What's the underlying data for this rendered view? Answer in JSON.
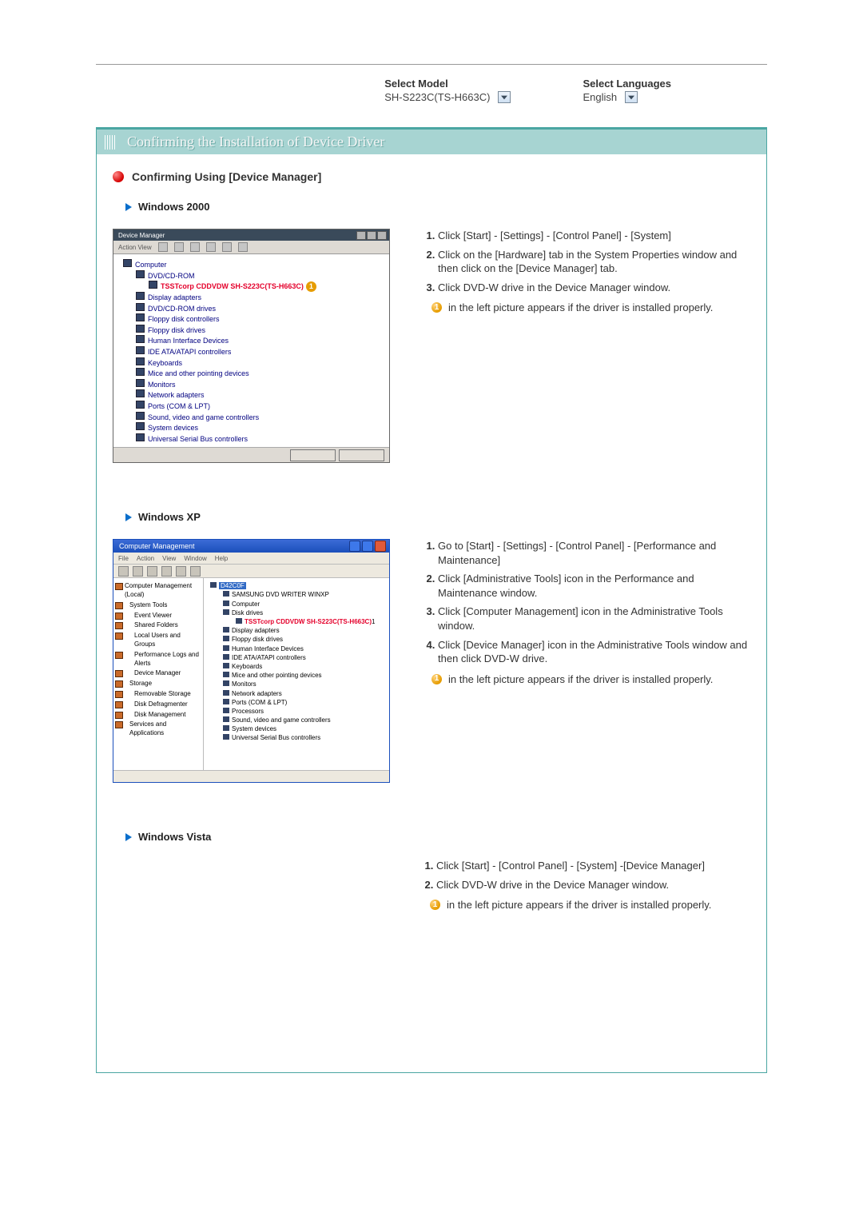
{
  "selectors": {
    "model_label": "Select Model",
    "model_value": "SH-S223C(TS-H663C)",
    "lang_label": "Select Languages",
    "lang_value": "English"
  },
  "title": "Confirming the Installation of Device Driver",
  "section_heading": "Confirming Using [Device Manager]",
  "sub_win2000": "Windows 2000",
  "sub_winxp": "Windows XP",
  "sub_vista": "Windows Vista",
  "proper_note": " in the left picture appears if the driver is installed properly.",
  "orb_glyph": "1",
  "win2000": {
    "window_title": "Device Manager",
    "menus": "Action  View",
    "tree": {
      "root": "Computer",
      "dvdcdrom": "DVD/CD-ROM",
      "device": "TSSTcorp CDDVDW SH-S223C(TS-H663C)",
      "items": [
        "Display adapters",
        "DVD/CD-ROM drives",
        "Floppy disk controllers",
        "Floppy disk drives",
        "Human Interface Devices",
        "IDE ATA/ATAPI controllers",
        "Keyboards",
        "Mice and other pointing devices",
        "Monitors",
        "Network adapters",
        "Ports (COM & LPT)",
        "Sound, video and game controllers",
        "System devices",
        "Universal Serial Bus controllers"
      ]
    },
    "steps": [
      "Click [Start] - [Settings] - [Control Panel] - [System]",
      "Click on the [Hardware] tab in the System Properties window and then click on the [Device Manager] tab.",
      "Click DVD-W drive in the Device Manager window."
    ]
  },
  "winxp": {
    "window_title": "Computer Management",
    "menus": [
      "File",
      "Action",
      "View",
      "Window",
      "Help"
    ],
    "left": [
      "Computer Management (Local)",
      "System Tools",
      "Event Viewer",
      "Shared Folders",
      "Local Users and Groups",
      "Performance Logs and Alerts",
      "Device Manager",
      "Storage",
      "Removable Storage",
      "Disk Defragmenter",
      "Disk Management",
      "Services and Applications"
    ],
    "right": {
      "root": "D42C0F",
      "line1": "SAMSUNG DVD WRITER WINXP",
      "device": "TSSTcorp CDDVDW SH-S223C(TS-H663C)",
      "items": [
        "Computer",
        "Disk drives",
        "Display adapters",
        "Floppy disk drives",
        "Human Interface Devices",
        "IDE ATA/ATAPI controllers",
        "Keyboards",
        "Mice and other pointing devices",
        "Monitors",
        "Network adapters",
        "Ports (COM & LPT)",
        "Processors",
        "Sound, video and game controllers",
        "System devices",
        "Universal Serial Bus controllers"
      ]
    },
    "steps": [
      "Go to [Start] - [Settings] - [Control Panel] - [Performance and Maintenance]",
      "Click [Administrative Tools] icon in the Performance and Maintenance window.",
      "Click [Computer Management] icon in the Administrative Tools window.",
      "Click [Device Manager] icon in the Administrative Tools window and then click DVD-W drive."
    ]
  },
  "vista": {
    "steps": [
      "Click [Start] - [Control Panel] - [System] -[Device Manager]",
      "Click DVD-W drive in the Device Manager window."
    ]
  }
}
